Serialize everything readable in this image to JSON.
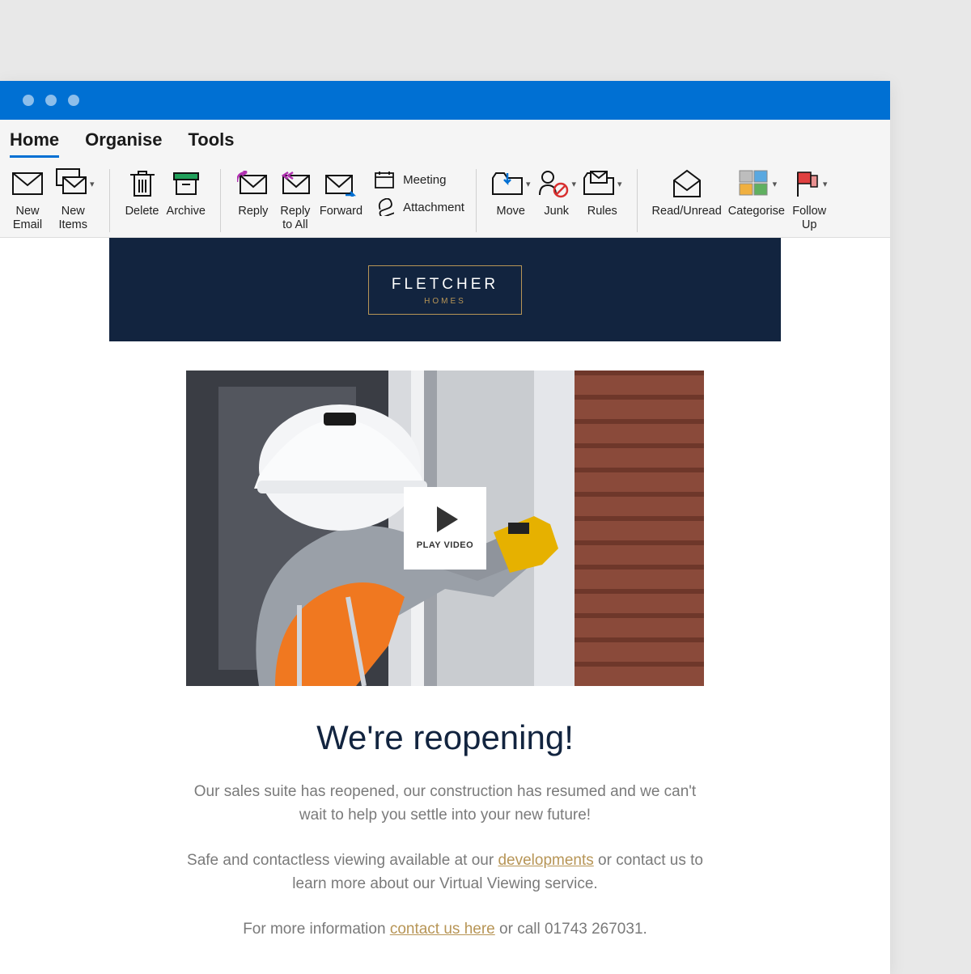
{
  "tabs": {
    "home": "Home",
    "organise": "Organise",
    "tools": "Tools"
  },
  "ribbon": {
    "new_email": "New\nEmail",
    "new_items": "New\nItems",
    "delete": "Delete",
    "archive": "Archive",
    "reply": "Reply",
    "reply_all": "Reply\nto All",
    "forward": "Forward",
    "meeting": "Meeting",
    "attachment": "Attachment",
    "move": "Move",
    "junk": "Junk",
    "rules": "Rules",
    "read_unread": "Read/Unread",
    "categorise": "Categorise",
    "follow_up": "Follow\nUp"
  },
  "email": {
    "brand_line1": "FLETCHER",
    "brand_line2": "HOMES",
    "play_label": "PLAY VIDEO",
    "headline": "We're reopening!",
    "para1": "Our sales suite has reopened, our construction has resumed and we can't wait to help you settle into your new future!",
    "para2_pre": "Safe and contactless viewing available at our ",
    "para2_link": "developments",
    "para2_post": " or contact us to learn more about our Virtual Viewing service.",
    "para3_pre": "For more information ",
    "para3_link": "contact us here",
    "para3_post": " or call 01743 267031."
  }
}
